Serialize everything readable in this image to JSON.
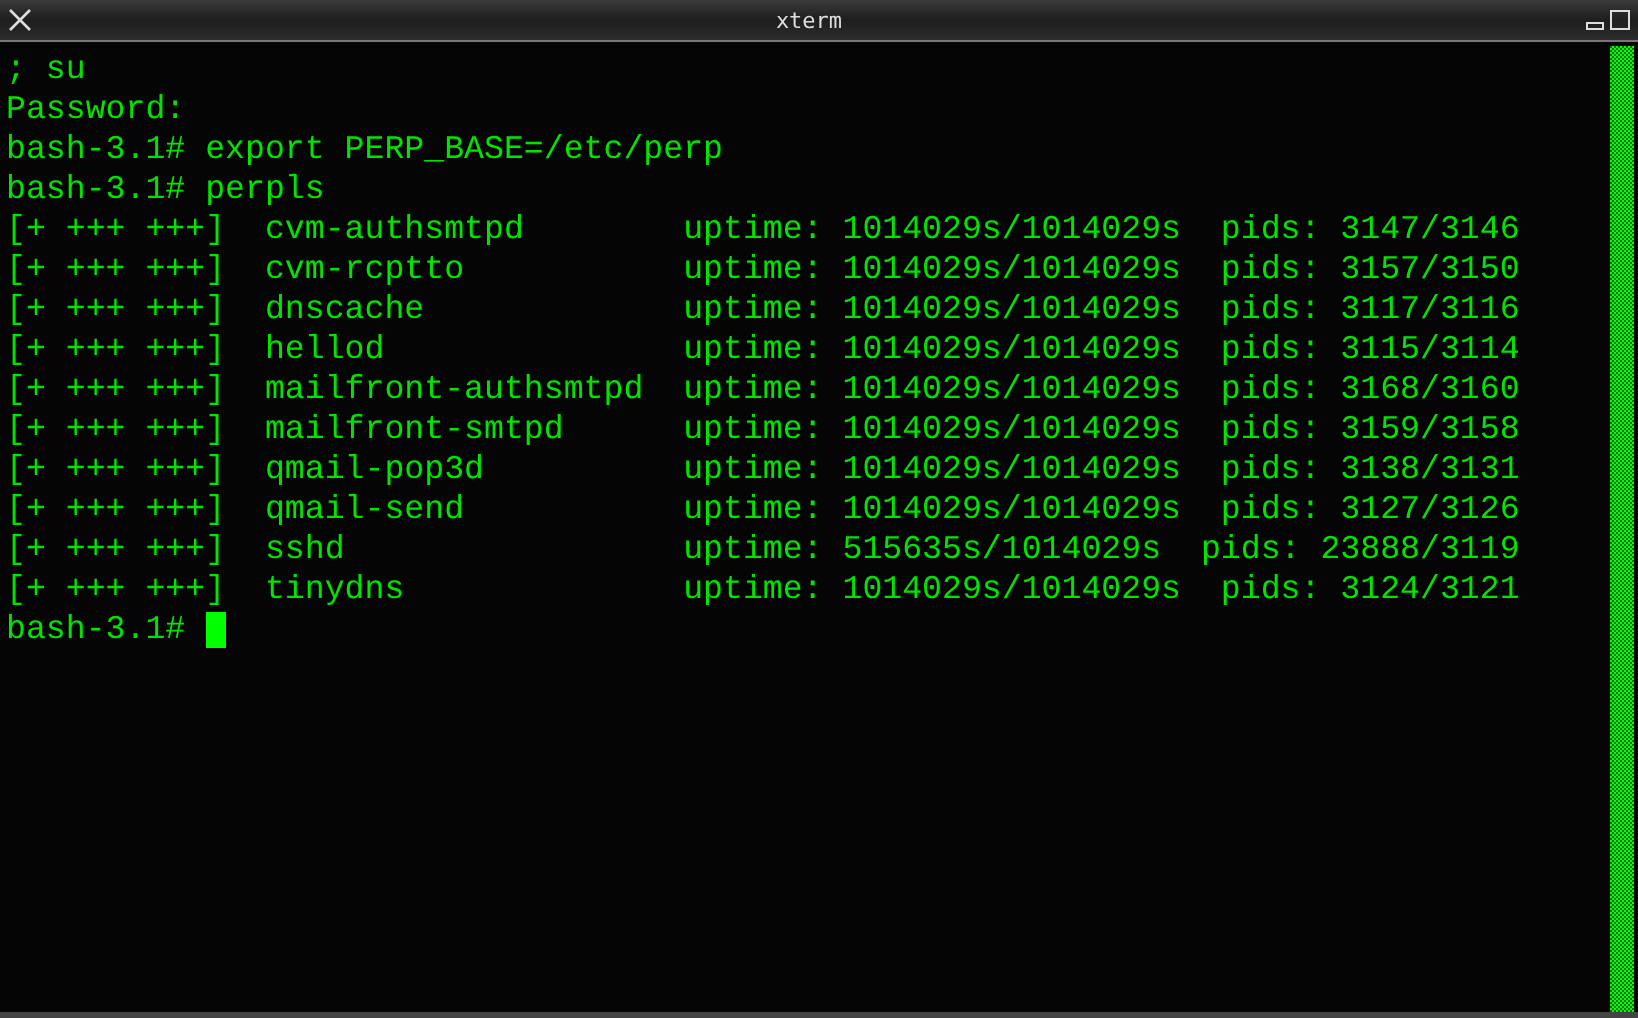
{
  "window": {
    "title": "xterm"
  },
  "terminal": {
    "lines": [
      "; su",
      "Password:",
      "bash-3.1# export PERP_BASE=/etc/perp",
      "bash-3.1# perpls",
      "[+ +++ +++]  cvm-authsmtpd        uptime: 1014029s/1014029s  pids: 3147/3146",
      "[+ +++ +++]  cvm-rcptto           uptime: 1014029s/1014029s  pids: 3157/3150",
      "[+ +++ +++]  dnscache             uptime: 1014029s/1014029s  pids: 3117/3116",
      "[+ +++ +++]  hellod               uptime: 1014029s/1014029s  pids: 3115/3114",
      "[+ +++ +++]  mailfront-authsmtpd  uptime: 1014029s/1014029s  pids: 3168/3160",
      "[+ +++ +++]  mailfront-smtpd      uptime: 1014029s/1014029s  pids: 3159/3158",
      "[+ +++ +++]  qmail-pop3d          uptime: 1014029s/1014029s  pids: 3138/3131",
      "[+ +++ +++]  qmail-send           uptime: 1014029s/1014029s  pids: 3127/3126",
      "[+ +++ +++]  sshd                 uptime: 515635s/1014029s  pids: 23888/3119",
      "[+ +++ +++]  tinydns              uptime: 1014029s/1014029s  pids: 3124/3121"
    ],
    "prompt": "bash-3.1#"
  }
}
